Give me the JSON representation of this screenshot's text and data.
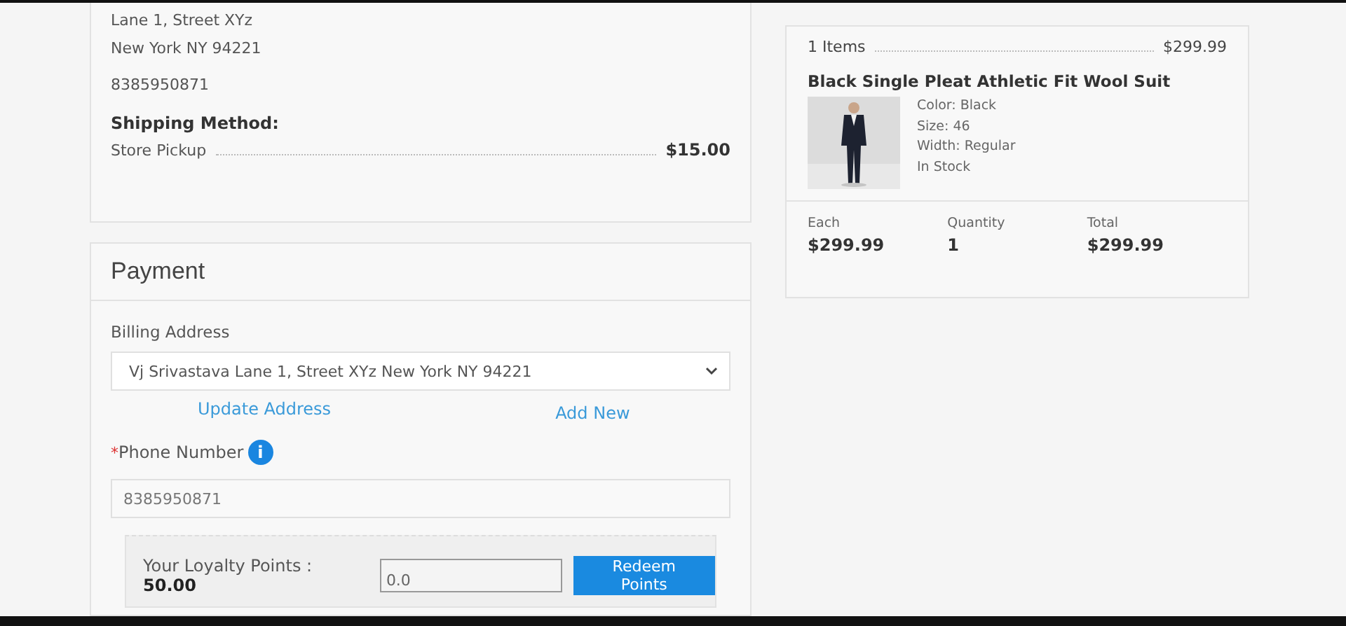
{
  "shipping_card": {
    "address_lines": [
      "Lane 1, Street XYz",
      "New York NY 94221"
    ],
    "phone": "8385950871",
    "method_label": "Shipping Method:",
    "method": "Store Pickup",
    "method_price": "$15.00"
  },
  "payment": {
    "title": "Payment",
    "billing_label": "Billing Address",
    "billing_value": "Vj Srivastava Lane 1, Street XYz New York NY 94221",
    "update_link": "Update Address",
    "add_link": "Add New",
    "phone_required_mark": "*",
    "phone_label": "Phone Number",
    "info_icon": "i",
    "phone_value": "8385950871",
    "loyalty_label": "Your Loyalty Points : ",
    "loyalty_points": "50.00",
    "redeem_value": "0.0",
    "redeem_button": "Redeem Points"
  },
  "order_summary": {
    "items_label": "1 Items",
    "items_total": "$299.99",
    "product": {
      "name": "Black Single Pleat Athletic Fit Wool Suit",
      "details": [
        "Color: Black",
        "Size: 46",
        "Width: Regular",
        "In Stock"
      ]
    },
    "columns": [
      {
        "label": "Each",
        "value": "$299.99"
      },
      {
        "label": "Quantity",
        "value": "1"
      },
      {
        "label": "Total",
        "value": "$299.99"
      }
    ]
  }
}
